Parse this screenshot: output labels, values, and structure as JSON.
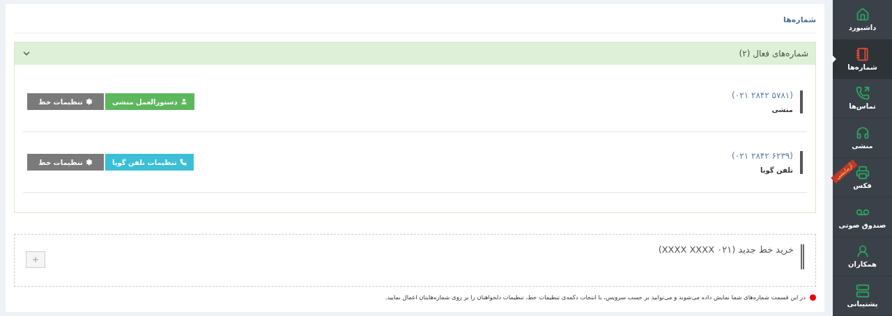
{
  "sidebar": {
    "items": [
      {
        "label": "داشبورد",
        "selected": false
      },
      {
        "label": "شماره‌ها",
        "selected": true
      },
      {
        "label": "تماس‌ها",
        "selected": false
      },
      {
        "label": "منشی",
        "selected": false
      },
      {
        "label": "فکس",
        "selected": false,
        "ribbon": "آزمایشی"
      },
      {
        "label": "صندوق صوتی",
        "selected": false
      },
      {
        "label": "همکاران",
        "selected": false
      },
      {
        "label": "پشتیبانی",
        "selected": false
      }
    ]
  },
  "page": {
    "title": "شماره‌ها"
  },
  "panel": {
    "title": "شماره‌های فعال (۲)",
    "expanded": true,
    "lines": [
      {
        "number": "(۰۲۱ ۲۸۴۲ ۵۷۸۱)",
        "label": "منشی",
        "buttons": [
          {
            "kind": "secretary",
            "label": "دستورالعمل منشی"
          },
          {
            "kind": "settings",
            "label": "تنظیمات خط"
          }
        ]
      },
      {
        "number": "(۰۲۱ ۲۸۴۲ ۶۲۳۹)",
        "label": "تلفن گویا",
        "buttons": [
          {
            "kind": "ivr",
            "label": "تنظیمات تلفن گویا"
          },
          {
            "kind": "settings",
            "label": "تنظیمات خط"
          }
        ]
      }
    ]
  },
  "buy": {
    "title": "خرید خط جدید (۰۲۱ XXXX XXXX)"
  },
  "note": "در این قسمت شماره‌های شما نمایش داده می‌شوند و می‌توانید بر حسب سرویس، با انتخاب دکمه‌ی تنظیمات خط، تنظیمات دلخواهتان را بر روی شماره‌هایتان اعمال نمایید."
}
